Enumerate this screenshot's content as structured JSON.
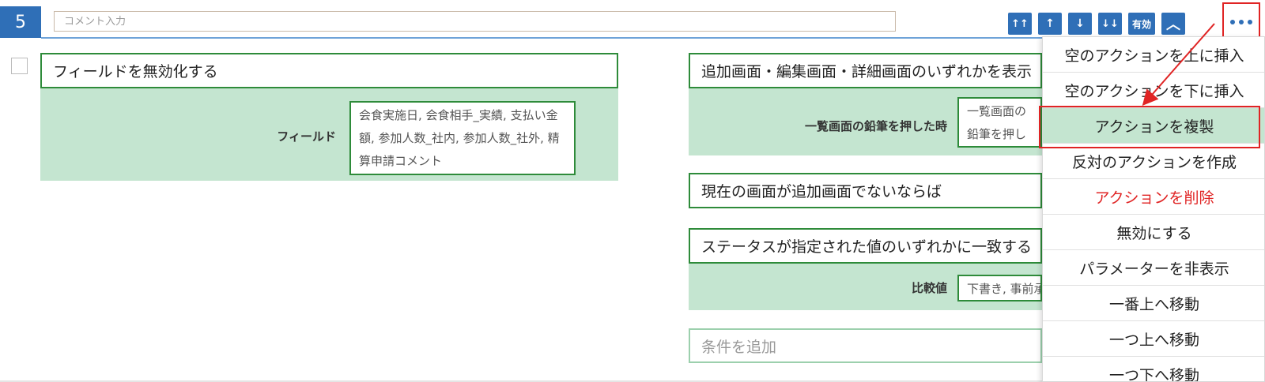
{
  "row": {
    "number": "5",
    "comment_placeholder": "コメント入力"
  },
  "toolbar": {
    "move_top": "⮅",
    "move_up": "↑",
    "move_down": "↓",
    "move_bottom": "⮇",
    "enabled_label": "有効",
    "collapse": "^"
  },
  "action": {
    "title": "フィールドを無効化する",
    "param_label": "フィールド",
    "param_value": "会食実施日, 会食相手_実績, 支払い金額, 参加人数_社内, 参加人数_社外, 精算申請コメント"
  },
  "conditions": [
    {
      "title": "追加画面・編集画面・詳細画面のいずれかを表示",
      "param_label": "一覧画面の鉛筆を押した時",
      "param_value": "一覧画面の鉛筆を押した時 ない"
    },
    {
      "title": "現在の画面が追加画面でないならば"
    },
    {
      "title": "ステータスが指定された値のいずれかに一致する",
      "param_label": "比較値",
      "param_value": "下書き, 事前承認"
    }
  ],
  "add_condition_placeholder": "条件を追加",
  "menu": {
    "items": [
      "空のアクションを上に挿入",
      "空のアクションを下に挿入",
      "アクションを複製",
      "反対のアクションを作成",
      "アクションを削除",
      "無効にする",
      "パラメーターを非表示",
      "一番上へ移動",
      "一つ上へ移動",
      "一つ下へ移動"
    ]
  },
  "colors": {
    "accent_blue": "#2f6fb7",
    "green_border": "#2e8b3a",
    "green_fill": "#c4e5d0",
    "annotation_red": "#e02424"
  }
}
